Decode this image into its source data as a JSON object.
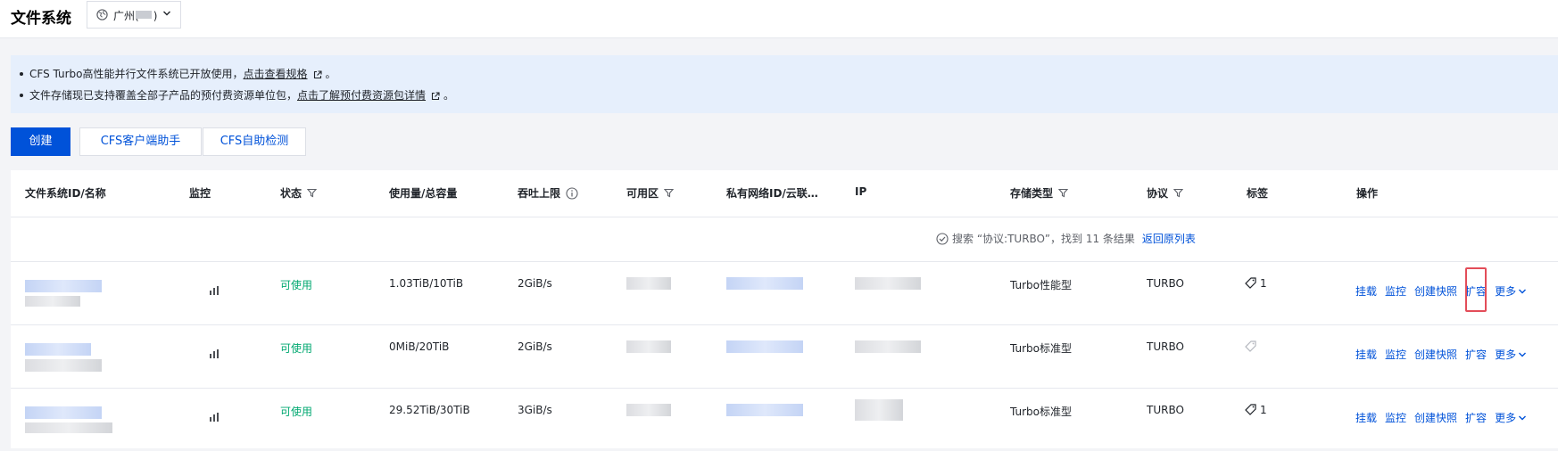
{
  "header": {
    "title": "文件系统",
    "region_label": "广州(",
    "region_suffix": ")"
  },
  "notices": [
    {
      "text": "CFS Turbo高性能并行文件系统已开放使用，",
      "link": "点击查看规格",
      "tail": "。"
    },
    {
      "text": "文件存储现已支持覆盖全部子产品的预付费资源单位包，",
      "link": "点击了解预付费资源包详情",
      "tail": "。"
    }
  ],
  "toolbar": {
    "create": "创建",
    "client_helper": "CFS客户端助手",
    "self_check": "CFS自助检测"
  },
  "columns": {
    "id_name": "文件系统ID/名称",
    "monitor": "监控",
    "status": "状态",
    "usage": "使用量/总容量",
    "throughput": "吞吐上限",
    "zone": "可用区",
    "vpc": "私有网络ID/云联…",
    "ip": "IP",
    "storage_type": "存储类型",
    "protocol": "协议",
    "tags": "标签",
    "actions": "操作"
  },
  "search_result": {
    "text": "搜索 “协议:TURBO”，找到 11 条结果",
    "back": "返回原列表"
  },
  "row_actions": {
    "mount": "挂载",
    "monitor": "监控",
    "snapshot": "创建快照",
    "expand": "扩容",
    "more": "更多"
  },
  "rows": [
    {
      "status": "可使用",
      "usage": "1.03TiB/10TiB",
      "throughput": "2GiB/s",
      "storage_type": "Turbo性能型",
      "protocol": "TURBO",
      "tag_count": "1"
    },
    {
      "status": "可使用",
      "usage": "0MiB/20TiB",
      "throughput": "2GiB/s",
      "storage_type": "Turbo标准型",
      "protocol": "TURBO",
      "tag_count": ""
    },
    {
      "status": "可使用",
      "usage": "29.52TiB/30TiB",
      "throughput": "3GiB/s",
      "storage_type": "Turbo标准型",
      "protocol": "TURBO",
      "tag_count": "1"
    }
  ],
  "colors": {
    "primary": "#0052d9",
    "success": "#00a870",
    "highlight": "#e34d59",
    "notice_bg": "#e6effc"
  }
}
